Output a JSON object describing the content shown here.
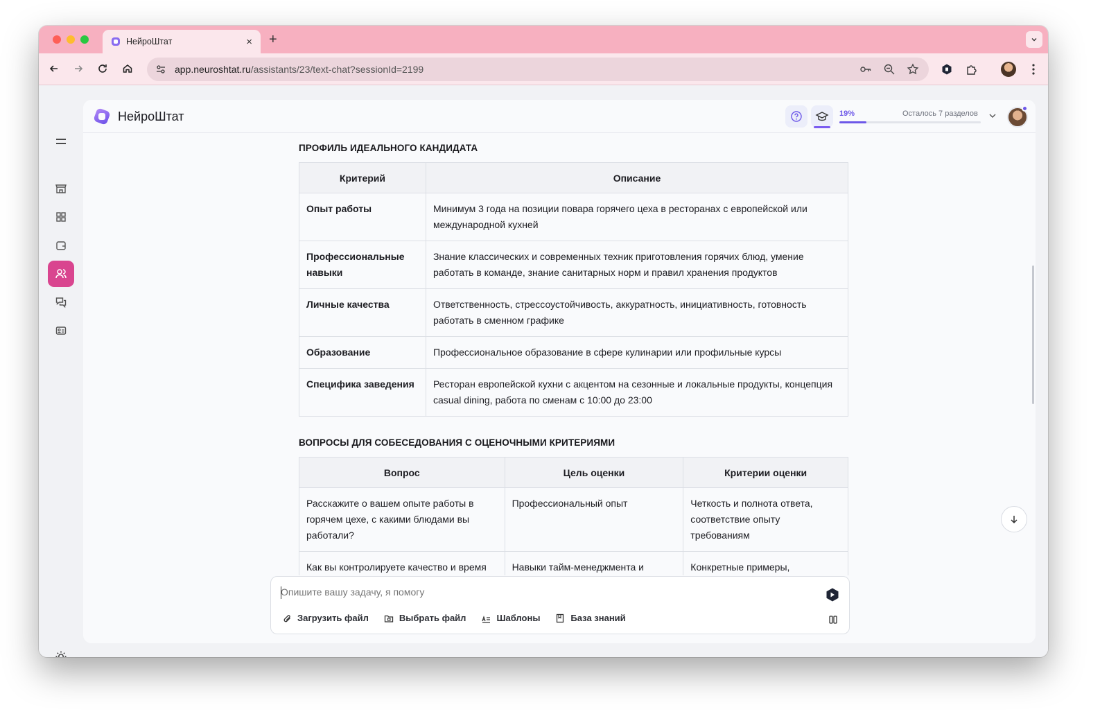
{
  "browser": {
    "tab_title": "НейроШтат",
    "new_tab": "+",
    "close": "×",
    "url_host": "app.neuroshtat.ru",
    "url_path": "/assistants/23/text-chat?sessionId=2199"
  },
  "app": {
    "logo_text": "НейроШтат",
    "progress_percent_label": "19%",
    "progress_fraction": 0.19,
    "progress_remaining": "Осталось 7 разделов",
    "accent_color": "#d9458f",
    "brand_color": "#6d58e8"
  },
  "sidebar": {
    "items": [
      {
        "name": "store-icon",
        "active": false
      },
      {
        "name": "dashboard-icon",
        "active": false
      },
      {
        "name": "wallet-icon",
        "active": false
      },
      {
        "name": "users-icon",
        "active": true
      },
      {
        "name": "chat-icon",
        "active": false
      },
      {
        "name": "id-card-icon",
        "active": false
      }
    ]
  },
  "profile_section": {
    "title": "ПРОФИЛЬ ИДЕАЛЬНОГО КАНДИДАТА",
    "headers": [
      "Критерий",
      "Описание"
    ],
    "rows": [
      [
        "Опыт работы",
        "Минимум 3 года на позиции повара горячего цеха в ресторанах с европейской или международной кухней"
      ],
      [
        "Профессиональные навыки",
        "Знание классических и современных техник приготовления горячих блюд, умение работать в команде, знание санитарных норм и правил хранения продуктов"
      ],
      [
        "Личные качества",
        "Ответственность, стрессоустойчивость, аккуратность, инициативность, готовность работать в сменном графике"
      ],
      [
        "Образование",
        "Профессиональное образование в сфере кулинарии или профильные курсы"
      ],
      [
        "Специфика заведения",
        "Ресторан европейской кухни с акцентом на сезонные и локальные продукты, концепция casual dining, работа по сменам с 10:00 до 23:00"
      ]
    ]
  },
  "questions_section": {
    "title": "ВОПРОСЫ ДЛЯ СОБЕСЕДОВАНИЯ С ОЦЕНОЧНЫМИ КРИТЕРИЯМИ",
    "headers": [
      "Вопрос",
      "Цель оценки",
      "Критерии оценки"
    ],
    "rows": [
      [
        "Расскажите о вашем опыте работы в горячем цехе, с какими блюдами вы работали?",
        "Профессиональный опыт",
        "Четкость и полнота ответа, соответствие опыту требованиям"
      ],
      [
        "Как вы контролируете качество и время",
        "Навыки тайм-менеджмента и",
        "Конкретные примеры,"
      ]
    ]
  },
  "composer": {
    "placeholder": "Опишите вашу задачу, я помогу",
    "actions": [
      {
        "label": "Загрузить файл",
        "icon": "paperclip-icon"
      },
      {
        "label": "Выбрать файл",
        "icon": "folder-icon"
      },
      {
        "label": "Шаблоны",
        "icon": "templates-icon"
      },
      {
        "label": "База знаний",
        "icon": "book-icon"
      }
    ]
  }
}
